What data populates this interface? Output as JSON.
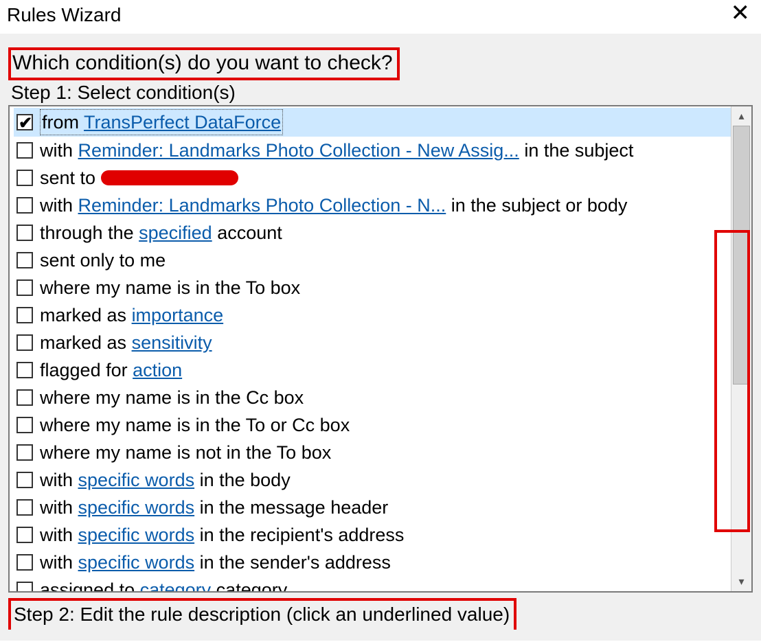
{
  "window": {
    "title": "Rules Wizard"
  },
  "heading": "Which condition(s) do you want to check?",
  "step1_label": "Step 1: Select condition(s)",
  "step2_label": "Step 2: Edit the rule description (click an underlined value)",
  "conditions": [
    {
      "checked": true,
      "selected": true,
      "parts": [
        {
          "t": "from "
        },
        {
          "t": "TransPerfect DataForce",
          "link": true
        }
      ]
    },
    {
      "checked": false,
      "parts": [
        {
          "t": "with "
        },
        {
          "t": "Reminder: Landmarks Photo Collection - New Assig...",
          "link": true
        },
        {
          "t": " in the subject"
        }
      ]
    },
    {
      "checked": false,
      "parts": [
        {
          "t": "sent to "
        },
        {
          "redact": true
        }
      ]
    },
    {
      "checked": false,
      "parts": [
        {
          "t": "with "
        },
        {
          "t": "Reminder: Landmarks Photo Collection - N...",
          "link": true
        },
        {
          "t": " in the subject or body"
        }
      ]
    },
    {
      "checked": false,
      "parts": [
        {
          "t": "through the "
        },
        {
          "t": "specified",
          "link": true
        },
        {
          "t": " account"
        }
      ]
    },
    {
      "checked": false,
      "parts": [
        {
          "t": "sent only to me"
        }
      ]
    },
    {
      "checked": false,
      "parts": [
        {
          "t": "where my name is in the To box"
        }
      ]
    },
    {
      "checked": false,
      "parts": [
        {
          "t": "marked as "
        },
        {
          "t": "importance",
          "link": true
        }
      ]
    },
    {
      "checked": false,
      "parts": [
        {
          "t": "marked as "
        },
        {
          "t": "sensitivity",
          "link": true
        }
      ]
    },
    {
      "checked": false,
      "parts": [
        {
          "t": "flagged for "
        },
        {
          "t": "action",
          "link": true
        }
      ]
    },
    {
      "checked": false,
      "parts": [
        {
          "t": "where my name is in the Cc box"
        }
      ]
    },
    {
      "checked": false,
      "parts": [
        {
          "t": "where my name is in the To or Cc box"
        }
      ]
    },
    {
      "checked": false,
      "parts": [
        {
          "t": "where my name is not in the To box"
        }
      ]
    },
    {
      "checked": false,
      "parts": [
        {
          "t": "with "
        },
        {
          "t": "specific words",
          "link": true
        },
        {
          "t": " in the body"
        }
      ]
    },
    {
      "checked": false,
      "parts": [
        {
          "t": "with "
        },
        {
          "t": "specific words",
          "link": true
        },
        {
          "t": " in the message header"
        }
      ]
    },
    {
      "checked": false,
      "parts": [
        {
          "t": "with "
        },
        {
          "t": "specific words",
          "link": true
        },
        {
          "t": " in the recipient's address"
        }
      ]
    },
    {
      "checked": false,
      "parts": [
        {
          "t": "with "
        },
        {
          "t": "specific words",
          "link": true
        },
        {
          "t": " in the sender's address"
        }
      ]
    },
    {
      "checked": false,
      "parts": [
        {
          "t": "assigned to "
        },
        {
          "t": "category",
          "link": true
        },
        {
          "t": " category"
        }
      ]
    }
  ]
}
